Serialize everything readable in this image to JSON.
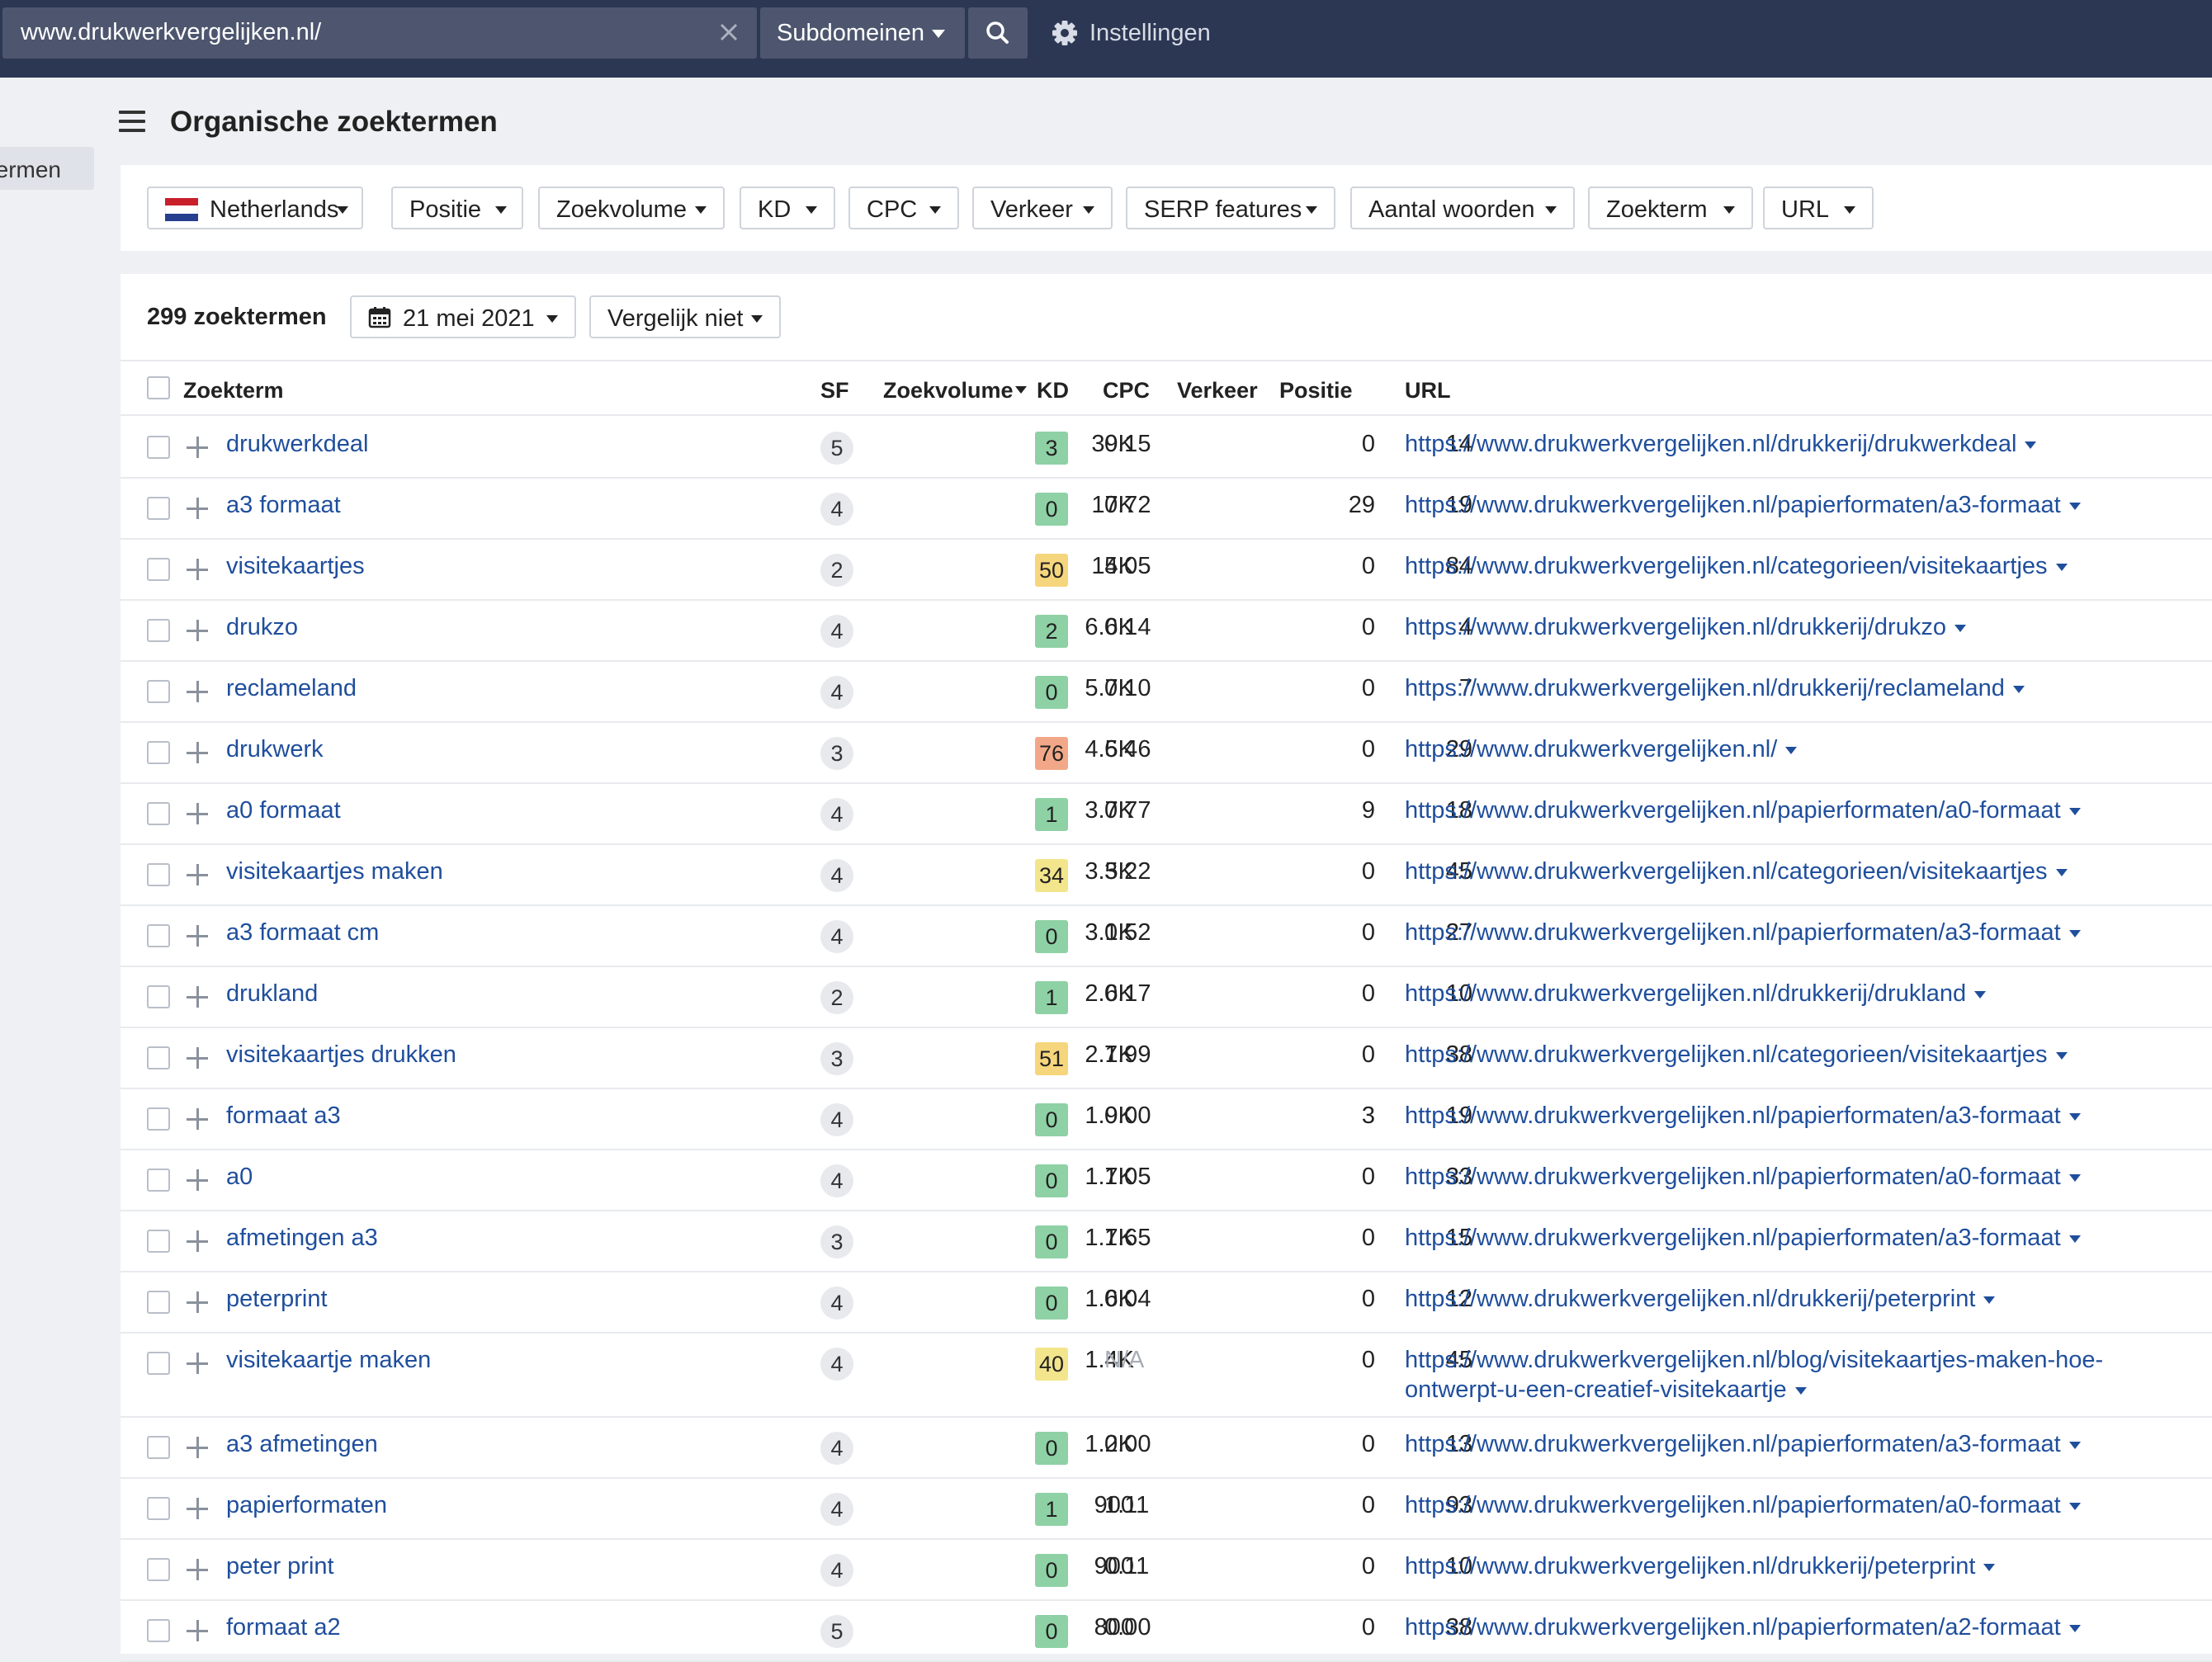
{
  "topbar": {
    "url_value": "www.drukwerkvergelijken.nl/",
    "mode_label": "Subdomeinen",
    "settings_label": "Instellingen"
  },
  "sidebar": {
    "active_item_label": "ermen"
  },
  "page": {
    "title": "Organische zoektermen"
  },
  "filters": {
    "country": "Netherlands",
    "position": "Positie",
    "volume": "Zoekvolume",
    "kd": "KD",
    "cpc": "CPC",
    "traffic": "Verkeer",
    "serp": "SERP features",
    "words": "Aantal woorden",
    "term": "Zoekterm",
    "url": "URL"
  },
  "results": {
    "count_label": "299 zoektermen",
    "date_label": "21 mei 2021",
    "compare_label": "Vergelijk niet"
  },
  "table": {
    "headers": {
      "keyword": "Zoekterm",
      "sf": "SF",
      "volume": "Zoekvolume",
      "kd": "KD",
      "cpc": "CPC",
      "traffic": "Verkeer",
      "position": "Positie",
      "url": "URL"
    },
    "rows": [
      {
        "keyword": "drukwerkdeal",
        "sf": "5",
        "volume": "39K",
        "kd": "3",
        "kd_color": "#8ed1a5",
        "cpc": "0.15",
        "traffic": "0",
        "position": "14",
        "url": "https://www.drukwerkvergelijken.nl/drukkerij/drukwerkdeal"
      },
      {
        "keyword": "a3 formaat",
        "sf": "4",
        "volume": "17K",
        "kd": "0",
        "kd_color": "#8ed1a5",
        "cpc": "0.72",
        "traffic": "29",
        "position": "19",
        "url": "https://www.drukwerkvergelijken.nl/papierformaten/a3-formaat"
      },
      {
        "keyword": "visitekaartjes",
        "sf": "2",
        "volume": "14K",
        "kd": "50",
        "kd_color": "#f6d67c",
        "cpc": "5.05",
        "traffic": "0",
        "position": "84",
        "url": "https://www.drukwerkvergelijken.nl/categorieen/visitekaartjes"
      },
      {
        "keyword": "drukzo",
        "sf": "4",
        "volume": "6.6K",
        "kd": "2",
        "kd_color": "#8ed1a5",
        "cpc": "0.14",
        "traffic": "0",
        "position": "4",
        "url": "https://www.drukwerkvergelijken.nl/drukkerij/drukzo"
      },
      {
        "keyword": "reclameland",
        "sf": "4",
        "volume": "5.7K",
        "kd": "0",
        "kd_color": "#8ed1a5",
        "cpc": "0.10",
        "traffic": "0",
        "position": "7",
        "url": "https://www.drukwerkvergelijken.nl/drukkerij/reclameland"
      },
      {
        "keyword": "drukwerk",
        "sf": "3",
        "volume": "4.5K",
        "kd": "76",
        "kd_color": "#f2a888",
        "cpc": "6.46",
        "traffic": "0",
        "position": "29",
        "url": "https://www.drukwerkvergelijken.nl/"
      },
      {
        "keyword": "a0 formaat",
        "sf": "4",
        "volume": "3.7K",
        "kd": "1",
        "kd_color": "#8ed1a5",
        "cpc": "0.77",
        "traffic": "9",
        "position": "18",
        "url": "https://www.drukwerkvergelijken.nl/papierformaten/a0-formaat"
      },
      {
        "keyword": "visitekaartjes maken",
        "sf": "4",
        "volume": "3.5K",
        "kd": "34",
        "kd_color": "#f3e58c",
        "cpc": "3.22",
        "traffic": "0",
        "position": "45",
        "url": "https://www.drukwerkvergelijken.nl/categorieen/visitekaartjes"
      },
      {
        "keyword": "a3 formaat cm",
        "sf": "4",
        "volume": "3.1K",
        "kd": "0",
        "kd_color": "#8ed1a5",
        "cpc": "0.52",
        "traffic": "0",
        "position": "27",
        "url": "https://www.drukwerkvergelijken.nl/papierformaten/a3-formaat"
      },
      {
        "keyword": "drukland",
        "sf": "2",
        "volume": "2.6K",
        "kd": "1",
        "kd_color": "#8ed1a5",
        "cpc": "0.17",
        "traffic": "0",
        "position": "10",
        "url": "https://www.drukwerkvergelijken.nl/drukkerij/drukland"
      },
      {
        "keyword": "visitekaartjes drukken",
        "sf": "3",
        "volume": "2.1K",
        "kd": "51",
        "kd_color": "#f6d67c",
        "cpc": "7.99",
        "traffic": "0",
        "position": "38",
        "url": "https://www.drukwerkvergelijken.nl/categorieen/visitekaartjes"
      },
      {
        "keyword": "formaat a3",
        "sf": "4",
        "volume": "1.9K",
        "kd": "0",
        "kd_color": "#8ed1a5",
        "cpc": "0.00",
        "traffic": "3",
        "position": "19",
        "url": "https://www.drukwerkvergelijken.nl/papierformaten/a3-formaat"
      },
      {
        "keyword": "a0",
        "sf": "4",
        "volume": "1.7K",
        "kd": "0",
        "kd_color": "#8ed1a5",
        "cpc": "1.05",
        "traffic": "0",
        "position": "33",
        "url": "https://www.drukwerkvergelijken.nl/papierformaten/a0-formaat"
      },
      {
        "keyword": "afmetingen a3",
        "sf": "3",
        "volume": "1.7K",
        "kd": "0",
        "kd_color": "#8ed1a5",
        "cpc": "1.65",
        "traffic": "0",
        "position": "15",
        "url": "https://www.drukwerkvergelijken.nl/papierformaten/a3-formaat"
      },
      {
        "keyword": "peterprint",
        "sf": "4",
        "volume": "1.6K",
        "kd": "0",
        "kd_color": "#8ed1a5",
        "cpc": "0.04",
        "traffic": "0",
        "position": "12",
        "url": "https://www.drukwerkvergelijken.nl/drukkerij/peterprint"
      },
      {
        "keyword": "visitekaartje maken",
        "sf": "4",
        "volume": "1.4K",
        "kd": "40",
        "kd_color": "#f3e58c",
        "cpc": "N/A",
        "traffic": "0",
        "position": "45",
        "url": "https://www.drukwerkvergelijken.nl/blog/visitekaartjes-maken-hoe-ontwerpt-u-een-creatief-visitekaartje"
      },
      {
        "keyword": "a3 afmetingen",
        "sf": "4",
        "volume": "1.2K",
        "kd": "0",
        "kd_color": "#8ed1a5",
        "cpc": "0.00",
        "traffic": "0",
        "position": "13",
        "url": "https://www.drukwerkvergelijken.nl/papierformaten/a3-formaat"
      },
      {
        "keyword": "papierformaten",
        "sf": "4",
        "volume": "900",
        "kd": "1",
        "kd_color": "#8ed1a5",
        "cpc": "1.11",
        "traffic": "0",
        "position": "93",
        "url": "https://www.drukwerkvergelijken.nl/papierformaten/a0-formaat"
      },
      {
        "keyword": "peter print",
        "sf": "4",
        "volume": "900",
        "kd": "0",
        "kd_color": "#8ed1a5",
        "cpc": "0.11",
        "traffic": "0",
        "position": "10",
        "url": "https://www.drukwerkvergelijken.nl/drukkerij/peterprint"
      },
      {
        "keyword": "formaat a2",
        "sf": "5",
        "volume": "800",
        "kd": "0",
        "kd_color": "#8ed1a5",
        "cpc": "0.00",
        "traffic": "0",
        "position": "38",
        "url": "https://www.drukwerkvergelijken.nl/papierformaten/a2-formaat"
      }
    ]
  }
}
